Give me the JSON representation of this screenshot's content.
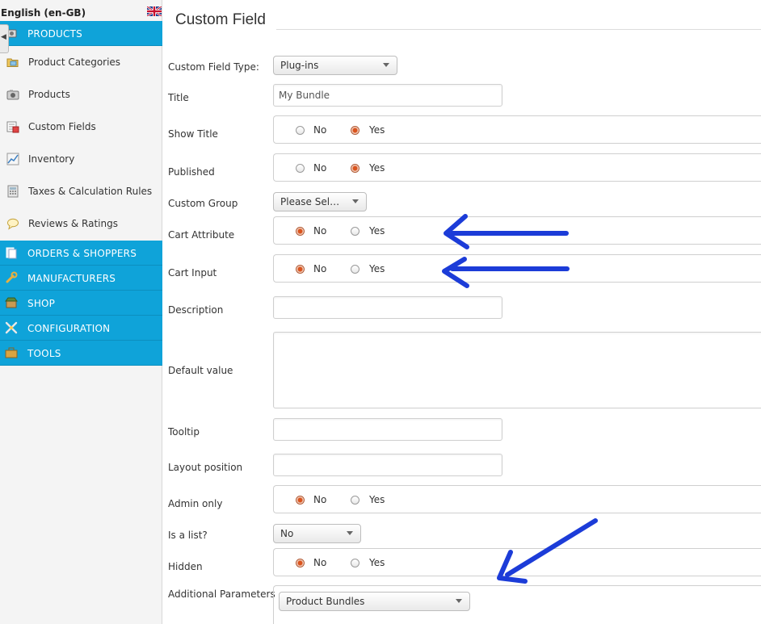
{
  "sidebar": {
    "language": "English (en-GB)",
    "sections": [
      {
        "label": "PRODUCTS"
      },
      {
        "label": "ORDERS & SHOPPERS"
      },
      {
        "label": "MANUFACTURERS"
      },
      {
        "label": "SHOP"
      },
      {
        "label": "CONFIGURATION"
      },
      {
        "label": "TOOLS"
      }
    ],
    "product_items": [
      {
        "label": "Product Categories",
        "icon": "folder-icon"
      },
      {
        "label": "Products",
        "icon": "camera-icon"
      },
      {
        "label": "Custom Fields",
        "icon": "custom-fields-icon"
      },
      {
        "label": "Inventory",
        "icon": "chart-icon"
      },
      {
        "label": "Taxes & Calculation Rules",
        "icon": "calculator-icon"
      },
      {
        "label": "Reviews & Ratings",
        "icon": "speech-bubble-icon"
      }
    ]
  },
  "page": {
    "title": "Custom Field"
  },
  "form": {
    "custom_field_type": {
      "label": "Custom Field Type:",
      "value": "Plug-ins"
    },
    "title": {
      "label": "Title",
      "value": "My Bundle"
    },
    "show_title": {
      "label": "Show Title",
      "no": "No",
      "yes": "Yes",
      "selected": "Yes"
    },
    "published": {
      "label": "Published",
      "no": "No",
      "yes": "Yes",
      "selected": "Yes"
    },
    "custom_group": {
      "label": "Custom Group",
      "value": "Please Sel…"
    },
    "cart_attribute": {
      "label": "Cart Attribute",
      "no": "No",
      "yes": "Yes",
      "selected": "No"
    },
    "cart_input": {
      "label": "Cart Input",
      "no": "No",
      "yes": "Yes",
      "selected": "No"
    },
    "description": {
      "label": "Description",
      "value": ""
    },
    "default_value": {
      "label": "Default value",
      "value": ""
    },
    "tooltip": {
      "label": "Tooltip",
      "value": ""
    },
    "layout_position": {
      "label": "Layout position",
      "value": ""
    },
    "admin_only": {
      "label": "Admin only",
      "no": "No",
      "yes": "Yes",
      "selected": "No"
    },
    "is_list": {
      "label": "Is a list?",
      "value": "No"
    },
    "hidden": {
      "label": "Hidden",
      "no": "No",
      "yes": "Yes",
      "selected": "No"
    },
    "additional_parameters": {
      "label": "Additional Parameters",
      "value": "Product Bundles"
    }
  },
  "colors": {
    "sidebar_header": "#0fa3d9",
    "annotation_arrow": "#1c3cd8",
    "radio_checked": "#d9541e"
  }
}
